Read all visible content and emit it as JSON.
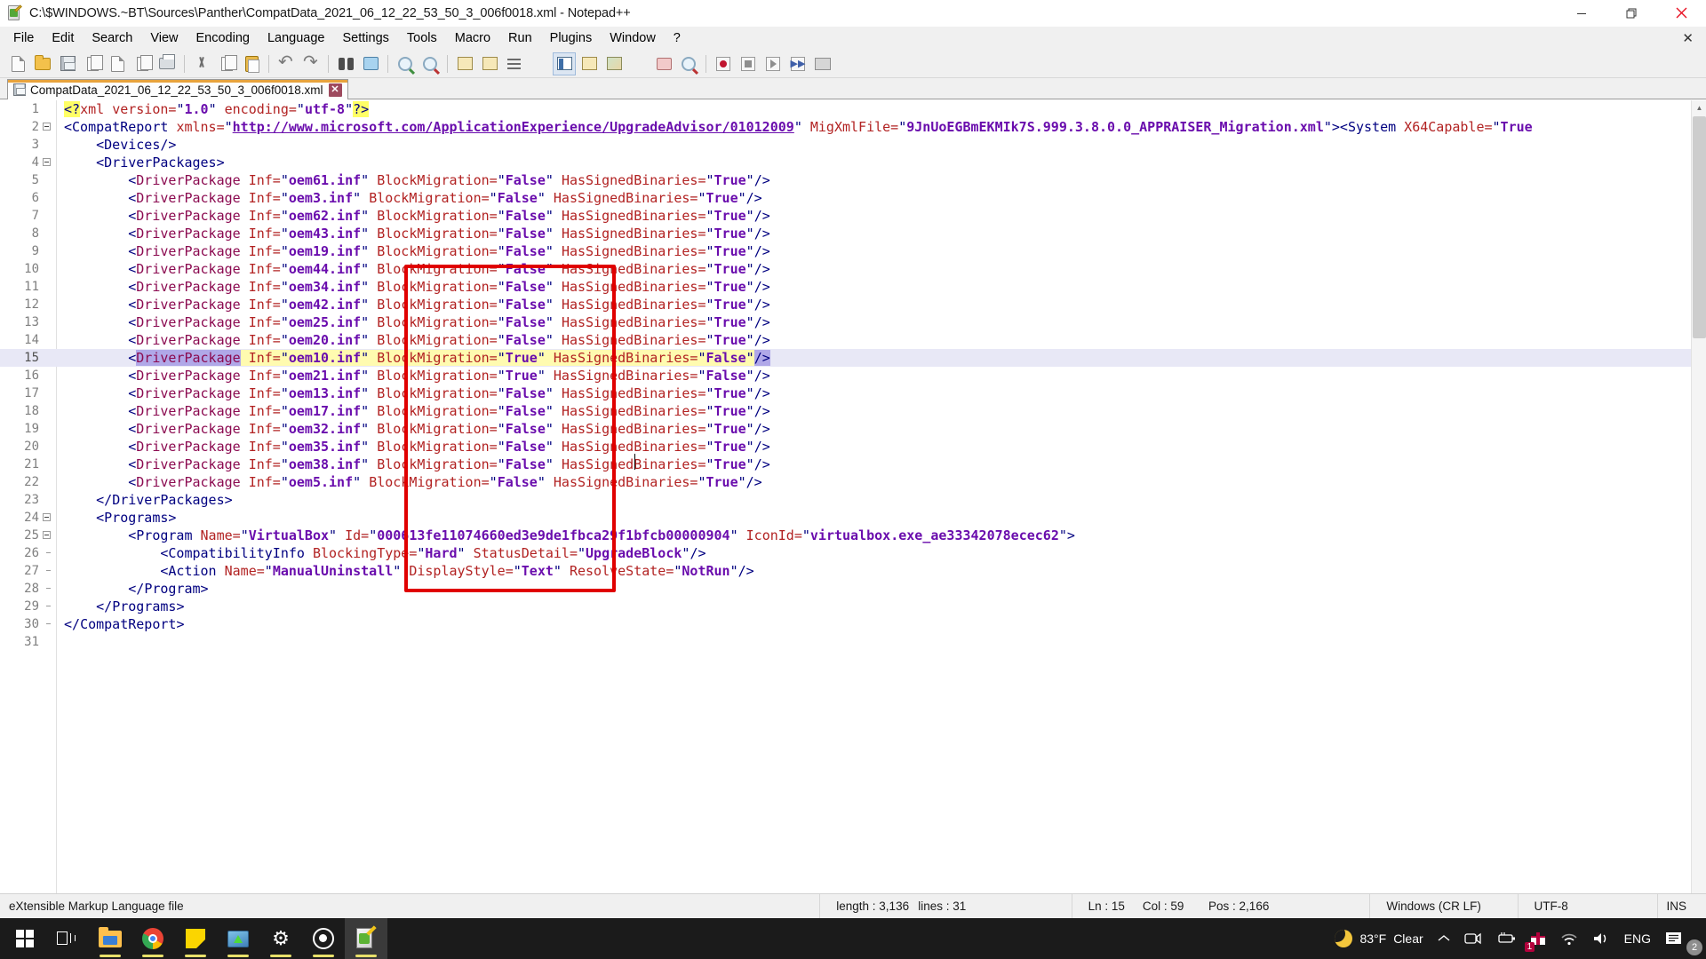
{
  "window": {
    "title": "C:\\$WINDOWS.~BT\\Sources\\Panther\\CompatData_2021_06_12_22_53_50_3_006f0018.xml - Notepad++",
    "icon": "notepadplusplus-icon",
    "minimize_label": "Minimize",
    "maximize_label": "Restore",
    "close_label": "Close"
  },
  "menubar": {
    "items": [
      {
        "label": "File"
      },
      {
        "label": "Edit"
      },
      {
        "label": "Search"
      },
      {
        "label": "View"
      },
      {
        "label": "Encoding"
      },
      {
        "label": "Language"
      },
      {
        "label": "Settings"
      },
      {
        "label": "Tools"
      },
      {
        "label": "Macro"
      },
      {
        "label": "Run"
      },
      {
        "label": "Plugins"
      },
      {
        "label": "Window"
      },
      {
        "label": "?"
      }
    ],
    "close_document": "✕"
  },
  "toolbar": {
    "buttons": [
      {
        "name": "new-file-icon",
        "glyph": "g-page"
      },
      {
        "name": "open-file-icon",
        "glyph": "g-folder"
      },
      {
        "name": "save-icon",
        "glyph": "g-save"
      },
      {
        "name": "save-all-icon",
        "glyph": "g-copy"
      },
      {
        "name": "close-file-icon",
        "glyph": "g-page"
      },
      {
        "name": "close-all-files-icon",
        "glyph": "g-copy"
      },
      {
        "name": "print-icon",
        "glyph": "g-print"
      },
      {
        "name": "sep",
        "glyph": "sep"
      },
      {
        "name": "cut-icon",
        "glyph": "g-scissors"
      },
      {
        "name": "copy-icon",
        "glyph": "g-copy"
      },
      {
        "name": "paste-icon",
        "glyph": "g-clip"
      },
      {
        "name": "sep",
        "glyph": "sep"
      },
      {
        "name": "undo-icon",
        "glyph": "g-undo"
      },
      {
        "name": "redo-icon",
        "glyph": "g-redo"
      },
      {
        "name": "sep",
        "glyph": "sep"
      },
      {
        "name": "find-icon",
        "glyph": "g-bino"
      },
      {
        "name": "replace-icon",
        "glyph": "g-repl"
      },
      {
        "name": "sep",
        "glyph": "sep"
      },
      {
        "name": "zoom-in-icon",
        "glyph": "g-zin"
      },
      {
        "name": "zoom-out-icon",
        "glyph": "g-zout"
      },
      {
        "name": "sep",
        "glyph": "sep"
      },
      {
        "name": "sync-vertical-scroll-icon",
        "glyph": "g-doclist"
      },
      {
        "name": "sync-horizontal-scroll-icon",
        "glyph": "g-doclist"
      },
      {
        "name": "word-wrap-icon",
        "glyph": "g-wrap"
      },
      {
        "name": "show-all-characters-icon",
        "glyph": "g-pilcrow"
      },
      {
        "name": "indent-guide-icon",
        "glyph": "g-panel",
        "selected": true
      },
      {
        "name": "user-defined-language-icon",
        "glyph": "g-doclist"
      },
      {
        "name": "document-map-icon",
        "glyph": "g-map"
      },
      {
        "name": "function-list-icon",
        "glyph": "g-fx"
      },
      {
        "name": "folder-as-workspace-icon",
        "glyph": "g-tabbar"
      },
      {
        "name": "monitoring-icon",
        "glyph": "g-zout"
      },
      {
        "name": "sep",
        "glyph": "sep"
      },
      {
        "name": "record-macro-icon",
        "glyph": "g-rec"
      },
      {
        "name": "stop-macro-icon",
        "glyph": "g-stop"
      },
      {
        "name": "play-macro-icon",
        "glyph": "g-play"
      },
      {
        "name": "run-macro-multiple-icon",
        "glyph": "g-ffwd"
      },
      {
        "name": "run-dialog-icon",
        "glyph": "g-macro"
      }
    ]
  },
  "tabs": [
    {
      "label": "CompatData_2021_06_12_22_53_50_3_006f0018.xml",
      "close": "✕",
      "active": true
    }
  ],
  "editor": {
    "total_lines": 31,
    "current_line": 15,
    "lines": [
      {
        "n": 1,
        "fold": "none",
        "html": "<span class=\"t-hl t-ang\">&lt;?</span><span class=\"t-pi\">xml</span> <span class=\"t-attr\">version=</span><span class=\"t-q\">\"</span><span class=\"t-val\">1.0</span><span class=\"t-q\">\"</span> <span class=\"t-attr\">encoding=</span><span class=\"t-q\">\"</span><span class=\"t-val\">utf-8</span><span class=\"t-q\">\"</span><span class=\"t-hl t-ang\">?&gt;</span>"
      },
      {
        "n": 2,
        "fold": "open",
        "indent": 0,
        "html": "<span class=\"t-ang\">&lt;</span><span class=\"t-plain\">CompatReport</span> <span class=\"t-attr\">xmlns=</span><span class=\"t-q\">\"</span><span class=\"t-link\">http://www.microsoft.com/ApplicationExperience/UpgradeAdvisor/01012009</span><span class=\"t-q\">\"</span> <span class=\"t-attr\">MigXmlFile=</span><span class=\"t-q\">\"</span><span class=\"t-val\">9JnUoEGBmEKMIk7S.999.3.8.0.0_APPRAISER_Migration.xml</span><span class=\"t-q\">\"</span><span class=\"t-ang\">&gt;&lt;</span><span class=\"t-plain\">System</span> <span class=\"t-attr\">X64Capable=</span><span class=\"t-q\">\"</span><span class=\"t-val\">True</span>"
      },
      {
        "n": 3,
        "fold": "none",
        "indent": 1,
        "html": "<span class=\"t-ang\">&lt;</span><span class=\"t-plain\">Devices/</span><span class=\"t-ang\">&gt;</span>"
      },
      {
        "n": 4,
        "fold": "open",
        "indent": 1,
        "html": "<span class=\"t-ang\">&lt;</span><span class=\"t-plain\">DriverPackages</span><span class=\"t-ang\">&gt;</span>"
      },
      {
        "n": 5,
        "fold": "none",
        "indent": 2,
        "driver": {
          "inf": "oem61.inf",
          "block": "False",
          "signed": "True"
        }
      },
      {
        "n": 6,
        "fold": "none",
        "indent": 2,
        "driver": {
          "inf": "oem3.inf",
          "block": "False",
          "signed": "True"
        }
      },
      {
        "n": 7,
        "fold": "none",
        "indent": 2,
        "driver": {
          "inf": "oem62.inf",
          "block": "False",
          "signed": "True"
        }
      },
      {
        "n": 8,
        "fold": "none",
        "indent": 2,
        "driver": {
          "inf": "oem43.inf",
          "block": "False",
          "signed": "True"
        }
      },
      {
        "n": 9,
        "fold": "none",
        "indent": 2,
        "driver": {
          "inf": "oem19.inf",
          "block": "False",
          "signed": "True"
        }
      },
      {
        "n": 10,
        "fold": "none",
        "indent": 2,
        "driver": {
          "inf": "oem44.inf",
          "block": "False",
          "signed": "True"
        }
      },
      {
        "n": 11,
        "fold": "none",
        "indent": 2,
        "driver": {
          "inf": "oem34.inf",
          "block": "False",
          "signed": "True"
        }
      },
      {
        "n": 12,
        "fold": "none",
        "indent": 2,
        "driver": {
          "inf": "oem42.inf",
          "block": "False",
          "signed": "True"
        }
      },
      {
        "n": 13,
        "fold": "none",
        "indent": 2,
        "driver": {
          "inf": "oem25.inf",
          "block": "False",
          "signed": "True"
        }
      },
      {
        "n": 14,
        "fold": "none",
        "indent": 2,
        "driver": {
          "inf": "oem20.inf",
          "block": "False",
          "signed": "True"
        }
      },
      {
        "n": 15,
        "fold": "none",
        "indent": 2,
        "current": true,
        "driver": {
          "inf": "oem10.inf",
          "block": "True",
          "signed": "False"
        }
      },
      {
        "n": 16,
        "fold": "none",
        "indent": 2,
        "driver": {
          "inf": "oem21.inf",
          "block": "True",
          "signed": "False"
        }
      },
      {
        "n": 17,
        "fold": "none",
        "indent": 2,
        "driver": {
          "inf": "oem13.inf",
          "block": "False",
          "signed": "True"
        }
      },
      {
        "n": 18,
        "fold": "none",
        "indent": 2,
        "driver": {
          "inf": "oem17.inf",
          "block": "False",
          "signed": "True"
        }
      },
      {
        "n": 19,
        "fold": "none",
        "indent": 2,
        "driver": {
          "inf": "oem32.inf",
          "block": "False",
          "signed": "True"
        }
      },
      {
        "n": 20,
        "fold": "none",
        "indent": 2,
        "driver": {
          "inf": "oem35.inf",
          "block": "False",
          "signed": "True"
        }
      },
      {
        "n": 21,
        "fold": "none",
        "indent": 2,
        "driver": {
          "inf": "oem38.inf",
          "block": "False",
          "signed": "True"
        }
      },
      {
        "n": 22,
        "fold": "none",
        "indent": 2,
        "driver": {
          "inf": "oem5.inf",
          "block": "False",
          "signed": "True"
        }
      },
      {
        "n": 23,
        "fold": "none",
        "indent": 1,
        "html": "<span class=\"t-ang\">&lt;/</span><span class=\"t-plain\">DriverPackages</span><span class=\"t-ang\">&gt;</span>"
      },
      {
        "n": 24,
        "fold": "open",
        "indent": 1,
        "html": "<span class=\"t-ang\">&lt;</span><span class=\"t-plain\">Programs</span><span class=\"t-ang\">&gt;</span>"
      },
      {
        "n": 25,
        "fold": "open",
        "indent": 2,
        "html": "<span class=\"t-ang\">&lt;</span><span class=\"t-plain\">Program</span> <span class=\"t-attr\">Name=</span><span class=\"t-q\">\"</span><span class=\"t-val\">VirtualBox</span><span class=\"t-q\">\"</span> <span class=\"t-attr\">Id=</span><span class=\"t-q\">\"</span><span class=\"t-val\">000613fe11074660ed3e9de1fbca29f1bfcb00000904</span><span class=\"t-q\">\"</span> <span class=\"t-attr\">IconId=</span><span class=\"t-q\">\"</span><span class=\"t-val\">virtualbox.exe_ae33342078ecec62</span><span class=\"t-q\">\"</span><span class=\"t-ang\">&gt;</span>"
      },
      {
        "n": 26,
        "fold": "none",
        "indent": 3,
        "html": "<span class=\"t-ang\">&lt;</span><span class=\"t-plain\">CompatibilityInfo</span> <span class=\"t-attr\">BlockingType=</span><span class=\"t-q\">\"</span><span class=\"t-val\">Hard</span><span class=\"t-q\">\"</span> <span class=\"t-attr\">StatusDetail=</span><span class=\"t-q\">\"</span><span class=\"t-val\">UpgradeBlock</span><span class=\"t-q\">\"</span><span class=\"t-ang\">/&gt;</span>"
      },
      {
        "n": 27,
        "fold": "none",
        "indent": 3,
        "html": "<span class=\"t-ang\">&lt;</span><span class=\"t-plain\">Action</span> <span class=\"t-attr\">Name=</span><span class=\"t-q\">\"</span><span class=\"t-val\">ManualUninstall</span><span class=\"t-q\">\"</span> <span class=\"t-attr\">DisplayStyle=</span><span class=\"t-q\">\"</span><span class=\"t-val\">Text</span><span class=\"t-q\">\"</span> <span class=\"t-attr\">ResolveState=</span><span class=\"t-q\">\"</span><span class=\"t-val\">NotRun</span><span class=\"t-q\">\"</span><span class=\"t-ang\">/&gt;</span>"
      },
      {
        "n": 28,
        "fold": "none",
        "indent": 2,
        "html": "<span class=\"t-ang\">&lt;/</span><span class=\"t-plain\">Program</span><span class=\"t-ang\">&gt;</span>"
      },
      {
        "n": 29,
        "fold": "none",
        "indent": 1,
        "html": "<span class=\"t-ang\">&lt;/</span><span class=\"t-plain\">Programs</span><span class=\"t-ang\">&gt;</span>"
      },
      {
        "n": 30,
        "fold": "none",
        "indent": 0,
        "html": "<span class=\"t-ang\">&lt;/</span><span class=\"t-plain\">CompatReport</span><span class=\"t-ang\">&gt;</span>"
      },
      {
        "n": 31,
        "fold": "none",
        "indent": 0,
        "html": ""
      }
    ],
    "annotation": {
      "name": "red-highlight-rectangle",
      "color": "#e00000",
      "covers": "BlockMigration attribute column, lines 5-22"
    }
  },
  "statusbar": {
    "file_type": "eXtensible Markup Language file",
    "length_label": "length : 3,136",
    "lines_label": "lines : 31",
    "ln": "Ln : 15",
    "col": "Col : 59",
    "pos": "Pos : 2,166",
    "eol": "Windows (CR LF)",
    "encoding": "UTF-8",
    "insert_mode": "INS"
  },
  "taskbar": {
    "items": [
      {
        "name": "start-button-icon",
        "glyph": "win"
      },
      {
        "name": "task-view-icon",
        "glyph": "taskview"
      },
      {
        "name": "file-explorer-icon",
        "glyph": "folder",
        "running": true
      },
      {
        "name": "google-chrome-icon",
        "glyph": "chrome",
        "running": true
      },
      {
        "name": "sticky-notes-icon",
        "glyph": "sticky",
        "running": true
      },
      {
        "name": "snipping-tool-icon",
        "glyph": "image",
        "running": true
      },
      {
        "name": "settings-icon",
        "glyph": "gear",
        "running": true
      },
      {
        "name": "obs-studio-icon",
        "glyph": "obs",
        "running": true
      },
      {
        "name": "notepadplusplus-icon",
        "glyph": "npp",
        "running": true,
        "active": true
      }
    ],
    "tray": {
      "weather_icon": "moon-icon",
      "weather_temp": "83°F",
      "weather_condition": "Clear",
      "overflow_icon": "chevron-up-icon",
      "camera_icon": "camera-icon",
      "battery_icon": "battery-icon",
      "gift_icon": "gift-icon",
      "gift_badge": "1",
      "network_icon": "wifi-icon",
      "volume_icon": "volume-icon",
      "language": "ENG",
      "notifications_icon": "notification-icon",
      "notifications_count": "2"
    }
  }
}
